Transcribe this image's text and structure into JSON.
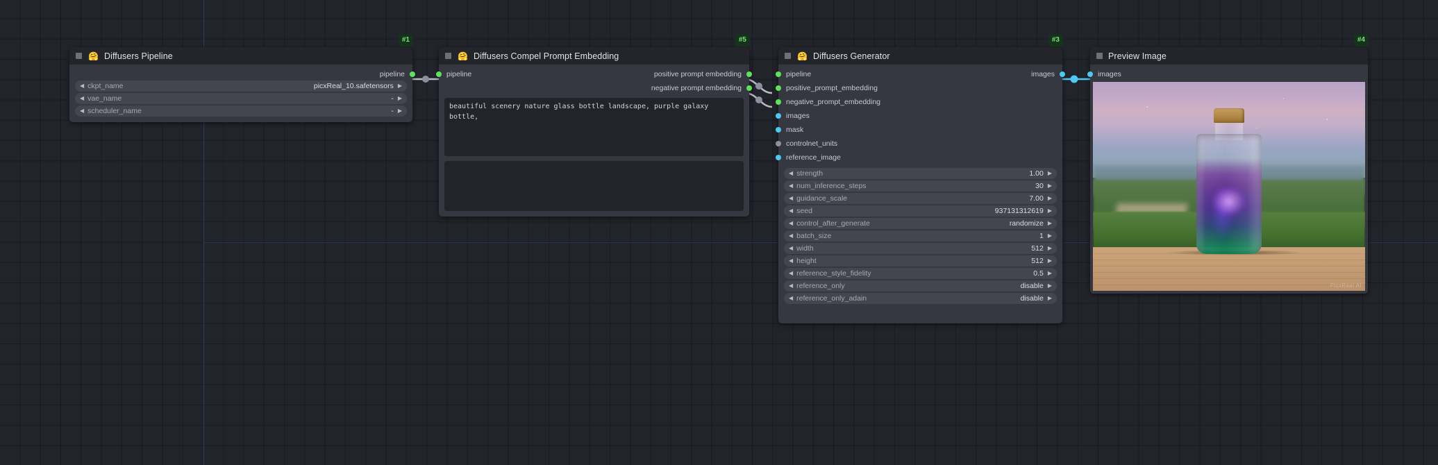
{
  "app": {
    "canvas_background": "#22242b",
    "grid_color": "#000000",
    "axis_color": "#2c4a78",
    "link_color_data": "#b9bbc2",
    "link_color_image": "#4ec8f0",
    "badge_bg": "#15321a",
    "badge_fg": "#7ee07e"
  },
  "nodes": [
    {
      "id": "diffusers-pipeline",
      "badge": "#1",
      "title": "Diffusers Pipeline",
      "emoji": "🤗",
      "has_emoji": true,
      "outputs": [
        {
          "label": "pipeline",
          "color": "#5fe35f",
          "type": "green"
        }
      ],
      "inputs": [],
      "widgets": [
        {
          "name": "ckpt_name",
          "value": "picxReal_10.safetensors"
        },
        {
          "name": "vae_name",
          "value": "-"
        },
        {
          "name": "scheduler_name",
          "value": "-"
        }
      ]
    },
    {
      "id": "diffusers-compel-prompt-embedding",
      "badge": "#5",
      "title": "Diffusers Compel Prompt Embedding",
      "emoji": "🤗",
      "has_emoji": true,
      "inputs": [
        {
          "label": "pipeline",
          "color": "#5fe35f",
          "type": "green"
        }
      ],
      "outputs": [
        {
          "label": "positive prompt embedding",
          "color": "#5fe35f",
          "type": "green"
        },
        {
          "label": "negative prompt embedding",
          "color": "#5fe35f",
          "type": "green"
        }
      ],
      "textareas": [
        {
          "name": "positive-prompt",
          "value": "beautiful scenery nature glass bottle landscape, purple galaxy bottle,"
        },
        {
          "name": "negative-prompt",
          "value": ""
        }
      ]
    },
    {
      "id": "diffusers-generator",
      "badge": "#3",
      "title": "Diffusers Generator",
      "emoji": "🤗",
      "has_emoji": true,
      "inputs": [
        {
          "label": "pipeline",
          "color": "#5fe35f",
          "type": "green"
        },
        {
          "label": "positive_prompt_embedding",
          "color": "#5fe35f",
          "type": "green"
        },
        {
          "label": "negative_prompt_embedding",
          "color": "#5fe35f",
          "type": "green"
        },
        {
          "label": "images",
          "color": "#4ec8f0",
          "type": "cyan"
        },
        {
          "label": "mask",
          "color": "#4ec8f0",
          "type": "cyan"
        },
        {
          "label": "controlnet_units",
          "color": "#8d8fa0",
          "type": "gray"
        },
        {
          "label": "reference_image",
          "color": "#4ec8f0",
          "type": "cyan"
        }
      ],
      "outputs": [
        {
          "label": "images",
          "color": "#4ec8f0",
          "type": "cyan"
        }
      ],
      "widgets": [
        {
          "name": "strength",
          "value": "1.00"
        },
        {
          "name": "num_inference_steps",
          "value": "30"
        },
        {
          "name": "guidance_scale",
          "value": "7.00"
        },
        {
          "name": "seed",
          "value": "937131312619"
        },
        {
          "name": "control_after_generate",
          "value": "randomize"
        },
        {
          "name": "batch_size",
          "value": "1"
        },
        {
          "name": "width",
          "value": "512"
        },
        {
          "name": "height",
          "value": "512"
        },
        {
          "name": "reference_style_fidelity",
          "value": "0.5"
        },
        {
          "name": "reference_only",
          "value": "disable"
        },
        {
          "name": "reference_only_adain",
          "value": "disable"
        }
      ]
    },
    {
      "id": "preview-image",
      "badge": "#4",
      "title": "Preview Image",
      "emoji": "",
      "has_emoji": false,
      "inputs": [
        {
          "label": "images",
          "color": "#4ec8f0",
          "type": "cyan"
        }
      ],
      "outputs": [],
      "preview": {
        "alt": "purple galaxy in a corked glass bottle on a wooden table in front of a green field at dusk",
        "watermark": "PicxReal AI"
      }
    }
  ],
  "icons": {
    "collapse": "collapse-box-icon",
    "widget_left": "◀",
    "widget_right": "▶"
  }
}
